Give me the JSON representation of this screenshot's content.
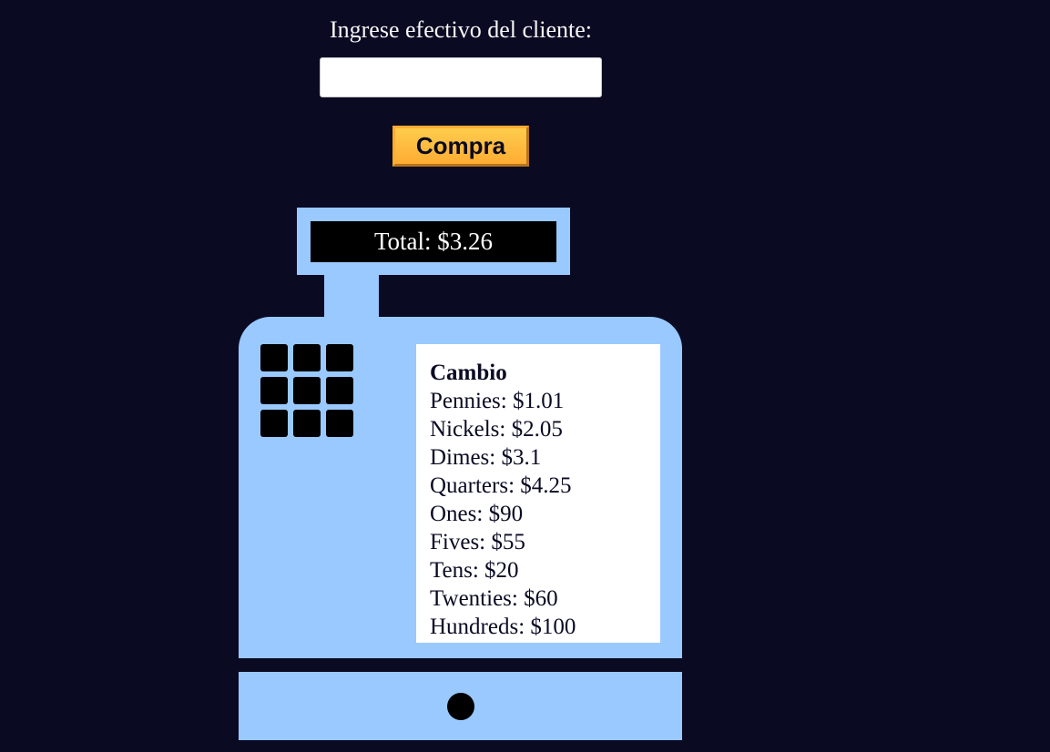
{
  "form": {
    "cash_label": "Ingrese efectivo del cliente:",
    "cash_value": "",
    "purchase_label": "Compra"
  },
  "register": {
    "total_text": "Total: $3.26",
    "change_title": "Cambio",
    "change_lines": [
      "Pennies: $1.01",
      "Nickels: $2.05",
      "Dimes: $3.1",
      "Quarters: $4.25",
      "Ones: $90",
      "Fives: $55",
      "Tens: $20",
      "Twenties: $60",
      "Hundreds: $100"
    ]
  },
  "colors": {
    "background": "#0a0a23",
    "register": "#99c9ff",
    "button": "#feac32",
    "display": "#000000"
  }
}
